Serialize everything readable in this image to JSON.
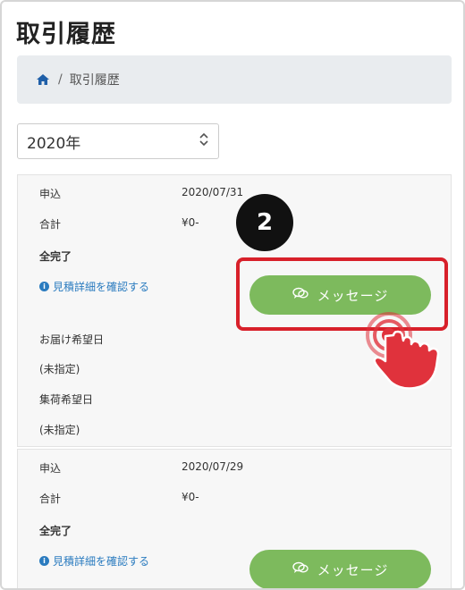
{
  "page": {
    "title": "取引履歴"
  },
  "breadcrumb": {
    "home_icon": "home-icon",
    "separator": "/",
    "current": "取引履歴"
  },
  "year_select": {
    "value": "2020年",
    "icon": "chevron-updown-icon"
  },
  "orders": [
    {
      "apply_label": "申込",
      "apply_date": "2020/07/31",
      "total_label": "合計",
      "total_value": "¥0-",
      "status": "全完了",
      "quote_link": "見積詳細を確認する",
      "message_button": "メッセージ",
      "delivery_label": "お届け希望日",
      "delivery_value": "(未指定)",
      "pickup_label": "集荷希望日",
      "pickup_value": "(未指定)"
    },
    {
      "apply_label": "申込",
      "apply_date": "2020/07/29",
      "total_label": "合計",
      "total_value": "¥0-",
      "status": "全完了",
      "quote_link": "見積詳細を確認する",
      "message_button": "メッセージ"
    }
  ],
  "annotation": {
    "step": "2",
    "highlight_color": "#d8202a",
    "pointer_icon": "hand-pointer-icon"
  },
  "colors": {
    "accent_green": "#7dba5d",
    "link_blue": "#2a7bbf"
  }
}
